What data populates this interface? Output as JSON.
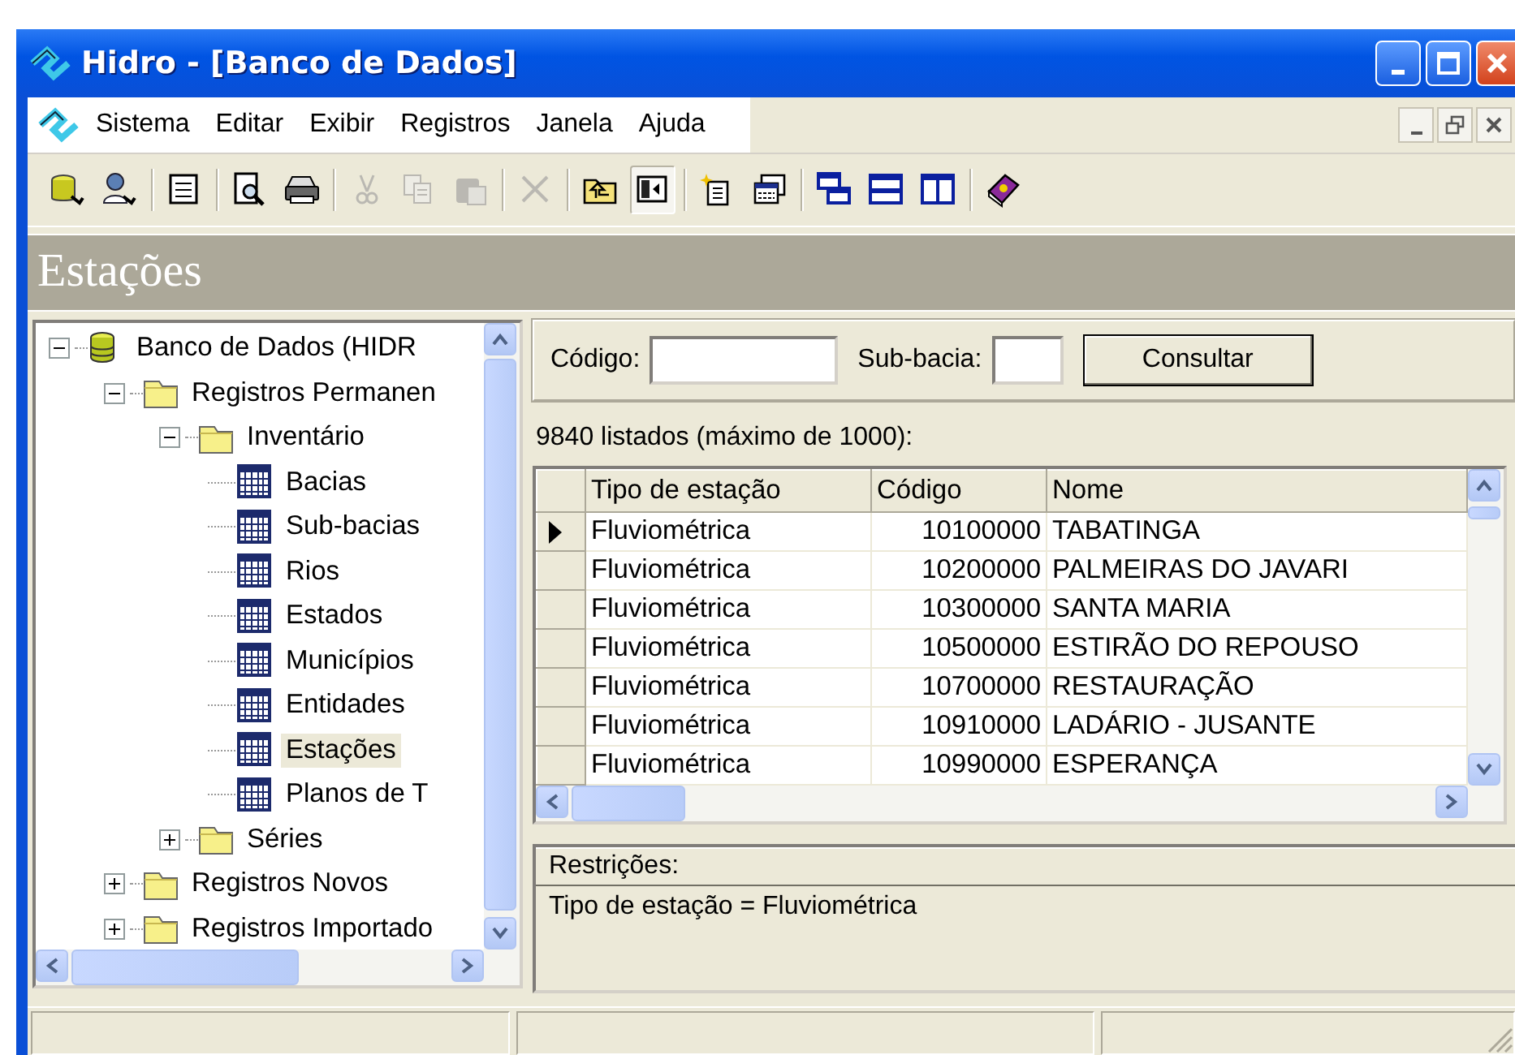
{
  "window": {
    "title": "Hidro - [Banco de Dados]"
  },
  "menu": [
    {
      "label": "Sistema"
    },
    {
      "label": "Editar"
    },
    {
      "label": "Exibir"
    },
    {
      "label": "Registros"
    },
    {
      "label": "Janela"
    },
    {
      "label": "Ajuda"
    }
  ],
  "toolbar": [
    [
      {
        "kind": "database",
        "disabled": false,
        "pressed": false
      },
      {
        "kind": "user",
        "disabled": false,
        "pressed": false
      }
    ],
    [
      {
        "kind": "form",
        "disabled": false,
        "pressed": false
      }
    ],
    [
      {
        "kind": "preview",
        "disabled": false,
        "pressed": false
      },
      {
        "kind": "print",
        "disabled": false,
        "pressed": false
      }
    ],
    [
      {
        "kind": "cut",
        "disabled": true,
        "pressed": false
      },
      {
        "kind": "copy",
        "disabled": true,
        "pressed": false
      },
      {
        "kind": "paste",
        "disabled": true,
        "pressed": false
      }
    ],
    [
      {
        "kind": "delete",
        "disabled": true,
        "pressed": false
      }
    ],
    [
      {
        "kind": "folder-up",
        "disabled": false,
        "pressed": false
      },
      {
        "kind": "panel",
        "disabled": false,
        "pressed": true
      }
    ],
    [
      {
        "kind": "new",
        "disabled": false,
        "pressed": false
      },
      {
        "kind": "windows",
        "disabled": false,
        "pressed": false
      }
    ],
    [
      {
        "kind": "cascade",
        "disabled": false,
        "pressed": false
      },
      {
        "kind": "tile-horizontal",
        "disabled": false,
        "pressed": false
      },
      {
        "kind": "tile-vertical",
        "disabled": false,
        "pressed": false
      }
    ],
    [
      {
        "kind": "help",
        "disabled": false,
        "pressed": false
      }
    ]
  ],
  "section_title": "Estações",
  "tree": [
    {
      "label": "Banco de Dados (HIDR",
      "kind": "database",
      "expanded": true,
      "selected": false,
      "children": [
        {
          "label": "Registros Permanen",
          "kind": "folder",
          "expanded": true,
          "selected": false,
          "children": [
            {
              "label": "Inventário",
              "kind": "folder",
              "expanded": true,
              "selected": false,
              "children": [
                {
                  "label": "Bacias",
                  "kind": "table",
                  "selected": false
                },
                {
                  "label": "Sub-bacias",
                  "kind": "table",
                  "selected": false
                },
                {
                  "label": "Rios",
                  "kind": "table",
                  "selected": false
                },
                {
                  "label": "Estados",
                  "kind": "table",
                  "selected": false
                },
                {
                  "label": "Municípios",
                  "kind": "table",
                  "selected": false
                },
                {
                  "label": "Entidades",
                  "kind": "table",
                  "selected": false
                },
                {
                  "label": "Estações",
                  "kind": "table",
                  "selected": true
                },
                {
                  "label": "Planos de T",
                  "kind": "table",
                  "selected": false
                }
              ]
            },
            {
              "label": "Séries",
              "kind": "folder",
              "expanded": false,
              "selected": false
            }
          ]
        },
        {
          "label": "Registros Novos",
          "kind": "folder",
          "expanded": false,
          "selected": false
        },
        {
          "label": "Registros Importado",
          "kind": "folder",
          "expanded": false,
          "selected": false
        }
      ]
    }
  ],
  "search": {
    "fields": [
      {
        "label": "Código:"
      },
      {
        "label": "Sub-bacia:"
      }
    ],
    "button": {
      "label": "Consultar"
    }
  },
  "count_text": "9840 listados (máximo de 1000):",
  "table": {
    "columns": [
      "Tipo de estação",
      "Código",
      "Nome"
    ],
    "rows": [
      {
        "selected": true,
        "cells": [
          "Fluviométrica",
          "10100000",
          "TABATINGA"
        ]
      },
      {
        "selected": false,
        "cells": [
          "Fluviométrica",
          "10200000",
          "PALMEIRAS DO JAVARI"
        ]
      },
      {
        "selected": false,
        "cells": [
          "Fluviométrica",
          "10300000",
          "SANTA MARIA"
        ]
      },
      {
        "selected": false,
        "cells": [
          "Fluviométrica",
          "10500000",
          "ESTIRÃO DO REPOUSO"
        ]
      },
      {
        "selected": false,
        "cells": [
          "Fluviométrica",
          "10700000",
          "RESTAURAÇÃO"
        ]
      },
      {
        "selected": false,
        "cells": [
          "Fluviométrica",
          "10910000",
          "LADÁRIO - JUSANTE"
        ]
      },
      {
        "selected": false,
        "cells": [
          "Fluviométrica",
          "10990000",
          "ESPERANÇA"
        ]
      }
    ]
  },
  "restrictions": {
    "title": "Restrições:",
    "text": "Tipo de estação = Fluviométrica"
  }
}
